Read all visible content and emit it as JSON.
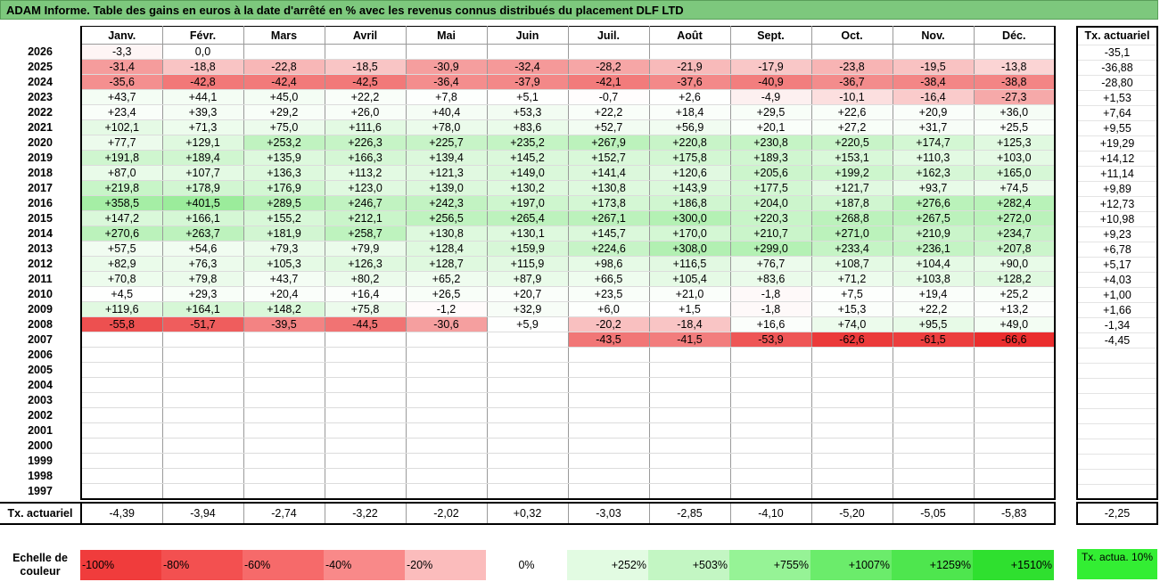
{
  "title": "ADAM Informe. Table des gains en euros à la date d'arrêté en % avec les revenus connus distribués du placement DLF LTD",
  "months": [
    "Janv.",
    "Févr.",
    "Mars",
    "Avril",
    "Mai",
    "Juin",
    "Juil.",
    "Août",
    "Sept.",
    "Oct.",
    "Nov.",
    "Déc."
  ],
  "side_header": "Tx. actuariel",
  "rows": [
    {
      "year": "2026",
      "cells": [
        "-3,3",
        "0,0",
        "",
        "",
        "",
        "",
        "",
        "",
        "",
        "",
        "",
        ""
      ],
      "rate": "-35,1"
    },
    {
      "year": "2025",
      "cells": [
        "-31,4",
        "-18,8",
        "-22,8",
        "-18,5",
        "-30,9",
        "-32,4",
        "-28,2",
        "-21,9",
        "-17,9",
        "-23,8",
        "-19,5",
        "-13,8"
      ],
      "rate": "-36,88"
    },
    {
      "year": "2024",
      "cells": [
        "-35,6",
        "-42,8",
        "-42,4",
        "-42,5",
        "-36,4",
        "-37,9",
        "-42,1",
        "-37,6",
        "-40,9",
        "-36,7",
        "-38,4",
        "-38,8"
      ],
      "rate": "-28,80"
    },
    {
      "year": "2023",
      "cells": [
        "+43,7",
        "+44,1",
        "+45,0",
        "+22,2",
        "+7,8",
        "+5,1",
        "-0,7",
        "+2,6",
        "-4,9",
        "-10,1",
        "-16,4",
        "-27,3"
      ],
      "rate": "+1,53"
    },
    {
      "year": "2022",
      "cells": [
        "+23,4",
        "+39,3",
        "+29,2",
        "+26,0",
        "+40,4",
        "+53,3",
        "+22,2",
        "+18,4",
        "+29,5",
        "+22,6",
        "+20,9",
        "+36,0"
      ],
      "rate": "+7,64"
    },
    {
      "year": "2021",
      "cells": [
        "+102,1",
        "+71,3",
        "+75,0",
        "+111,6",
        "+78,0",
        "+83,6",
        "+52,7",
        "+56,9",
        "+20,1",
        "+27,2",
        "+31,7",
        "+25,5"
      ],
      "rate": "+9,55"
    },
    {
      "year": "2020",
      "cells": [
        "+77,7",
        "+129,1",
        "+253,2",
        "+226,3",
        "+225,7",
        "+235,2",
        "+267,9",
        "+220,8",
        "+230,8",
        "+220,5",
        "+174,7",
        "+125,3"
      ],
      "rate": "+19,29"
    },
    {
      "year": "2019",
      "cells": [
        "+191,8",
        "+189,4",
        "+135,9",
        "+166,3",
        "+139,4",
        "+145,2",
        "+152,7",
        "+175,8",
        "+189,3",
        "+153,1",
        "+110,3",
        "+103,0"
      ],
      "rate": "+14,12"
    },
    {
      "year": "2018",
      "cells": [
        "+87,0",
        "+107,7",
        "+136,3",
        "+113,2",
        "+121,3",
        "+149,0",
        "+141,4",
        "+120,6",
        "+205,6",
        "+199,2",
        "+162,3",
        "+165,0"
      ],
      "rate": "+11,14"
    },
    {
      "year": "2017",
      "cells": [
        "+219,8",
        "+178,9",
        "+176,9",
        "+123,0",
        "+139,0",
        "+130,2",
        "+130,8",
        "+143,9",
        "+177,5",
        "+121,7",
        "+93,7",
        "+74,5"
      ],
      "rate": "+9,89"
    },
    {
      "year": "2016",
      "cells": [
        "+358,5",
        "+401,5",
        "+289,5",
        "+246,7",
        "+242,3",
        "+197,0",
        "+173,8",
        "+186,8",
        "+204,0",
        "+187,8",
        "+276,6",
        "+282,4"
      ],
      "rate": "+12,73"
    },
    {
      "year": "2015",
      "cells": [
        "+147,2",
        "+166,1",
        "+155,2",
        "+212,1",
        "+256,5",
        "+265,4",
        "+267,1",
        "+300,0",
        "+220,3",
        "+268,8",
        "+267,5",
        "+272,0"
      ],
      "rate": "+10,98"
    },
    {
      "year": "2014",
      "cells": [
        "+270,6",
        "+263,7",
        "+181,9",
        "+258,7",
        "+130,8",
        "+130,1",
        "+145,7",
        "+170,0",
        "+210,7",
        "+271,0",
        "+210,9",
        "+234,7"
      ],
      "rate": "+9,23"
    },
    {
      "year": "2013",
      "cells": [
        "+57,5",
        "+54,6",
        "+79,3",
        "+79,9",
        "+128,4",
        "+159,9",
        "+224,6",
        "+308,0",
        "+299,0",
        "+233,4",
        "+236,1",
        "+207,8"
      ],
      "rate": "+6,78"
    },
    {
      "year": "2012",
      "cells": [
        "+82,9",
        "+76,3",
        "+105,3",
        "+126,3",
        "+128,7",
        "+115,9",
        "+98,6",
        "+116,5",
        "+76,7",
        "+108,7",
        "+104,4",
        "+90,0"
      ],
      "rate": "+5,17"
    },
    {
      "year": "2011",
      "cells": [
        "+70,8",
        "+79,8",
        "+43,7",
        "+80,2",
        "+65,2",
        "+87,9",
        "+66,5",
        "+105,4",
        "+83,6",
        "+71,2",
        "+103,8",
        "+128,2"
      ],
      "rate": "+4,03"
    },
    {
      "year": "2010",
      "cells": [
        "+4,5",
        "+29,3",
        "+20,4",
        "+16,4",
        "+26,5",
        "+20,7",
        "+23,5",
        "+21,0",
        "-1,8",
        "+7,5",
        "+19,4",
        "+25,2"
      ],
      "rate": "+1,00"
    },
    {
      "year": "2009",
      "cells": [
        "+119,6",
        "+164,1",
        "+148,2",
        "+75,8",
        "-1,2",
        "+32,9",
        "+6,0",
        "+1,5",
        "-1,8",
        "+15,3",
        "+22,2",
        "+13,2"
      ],
      "rate": "+1,66"
    },
    {
      "year": "2008",
      "cells": [
        "-55,8",
        "-51,7",
        "-39,5",
        "-44,5",
        "-30,6",
        "+5,9",
        "-20,2",
        "-18,4",
        "+16,6",
        "+74,0",
        "+95,5",
        "+49,0"
      ],
      "rate": "-1,34"
    },
    {
      "year": "2007",
      "cells": [
        "",
        "",
        "",
        "",
        "",
        "",
        "-43,5",
        "-41,5",
        "-53,9",
        "-62,6",
        "-61,5",
        "-66,6"
      ],
      "rate": "-4,45"
    },
    {
      "year": "2006",
      "cells": [
        "",
        "",
        "",
        "",
        "",
        "",
        "",
        "",
        "",
        "",
        "",
        ""
      ],
      "rate": ""
    },
    {
      "year": "2005",
      "cells": [
        "",
        "",
        "",
        "",
        "",
        "",
        "",
        "",
        "",
        "",
        "",
        ""
      ],
      "rate": ""
    },
    {
      "year": "2004",
      "cells": [
        "",
        "",
        "",
        "",
        "",
        "",
        "",
        "",
        "",
        "",
        "",
        ""
      ],
      "rate": ""
    },
    {
      "year": "2003",
      "cells": [
        "",
        "",
        "",
        "",
        "",
        "",
        "",
        "",
        "",
        "",
        "",
        ""
      ],
      "rate": ""
    },
    {
      "year": "2002",
      "cells": [
        "",
        "",
        "",
        "",
        "",
        "",
        "",
        "",
        "",
        "",
        "",
        ""
      ],
      "rate": ""
    },
    {
      "year": "2001",
      "cells": [
        "",
        "",
        "",
        "",
        "",
        "",
        "",
        "",
        "",
        "",
        "",
        ""
      ],
      "rate": ""
    },
    {
      "year": "2000",
      "cells": [
        "",
        "",
        "",
        "",
        "",
        "",
        "",
        "",
        "",
        "",
        "",
        ""
      ],
      "rate": ""
    },
    {
      "year": "1999",
      "cells": [
        "",
        "",
        "",
        "",
        "",
        "",
        "",
        "",
        "",
        "",
        "",
        ""
      ],
      "rate": ""
    },
    {
      "year": "1998",
      "cells": [
        "",
        "",
        "",
        "",
        "",
        "",
        "",
        "",
        "",
        "",
        "",
        ""
      ],
      "rate": ""
    },
    {
      "year": "1997",
      "cells": [
        "",
        "",
        "",
        "",
        "",
        "",
        "",
        "",
        "",
        "",
        "",
        ""
      ],
      "rate": ""
    }
  ],
  "footer": {
    "label": "Tx. actuariel",
    "values": [
      "-4,39",
      "-3,94",
      "-2,74",
      "-3,22",
      "-2,02",
      "+0,32",
      "-3,03",
      "-2,85",
      "-4,10",
      "-5,20",
      "-5,05",
      "-5,83"
    ],
    "rate": "-2,25"
  },
  "scale": {
    "label": "Echelle de couleur",
    "steps": [
      {
        "label": "-100%",
        "color": "#f03c3c"
      },
      {
        "label": "-80%",
        "color": "#f35050"
      },
      {
        "label": "-60%",
        "color": "#f66a6a"
      },
      {
        "label": "-40%",
        "color": "#f98989"
      },
      {
        "label": "-20%",
        "color": "#fbbcbc"
      },
      {
        "label": "0%",
        "color": "#ffffff"
      },
      {
        "label": "+252%",
        "color": "#e2fbe2"
      },
      {
        "label": "+503%",
        "color": "#c3f6c3"
      },
      {
        "label": "+755%",
        "color": "#96f396"
      },
      {
        "label": "+1007%",
        "color": "#6bec6b"
      },
      {
        "label": "+1259%",
        "color": "#4ee64e"
      },
      {
        "label": "+1510%",
        "color": "#2fe02f"
      }
    ],
    "side_label": "Tx. actua. 10%",
    "side_color": "#33ee33"
  },
  "colors": {
    "title_bg": "#7dc87d"
  }
}
